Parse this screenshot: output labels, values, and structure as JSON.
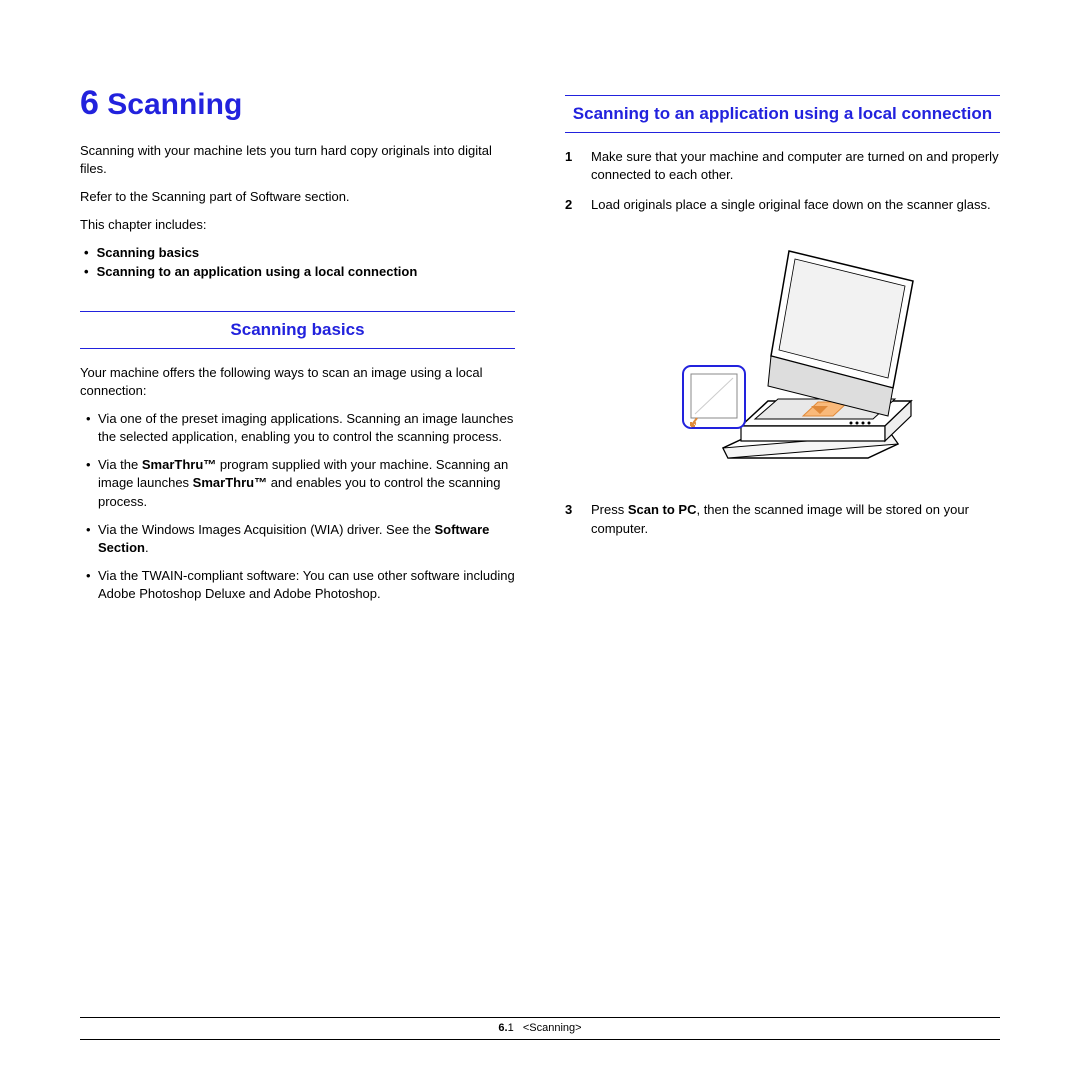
{
  "chapter": {
    "number": "6",
    "title": "Scanning"
  },
  "intro": {
    "p1": "Scanning with your machine lets you turn hard copy originals into digital files.",
    "p2": "Refer to the Scanning part of Software section.",
    "p3": "This chapter includes:"
  },
  "toc": {
    "item1": "Scanning basics",
    "item2": "Scanning to an application using a local connection"
  },
  "section1": {
    "heading": "Scanning basics",
    "intro": "Your machine offers the following ways to scan an image using a local connection:",
    "b1": "Via one of the preset imaging applications. Scanning an image launches the selected application, enabling you to control the scanning process.",
    "b2a": "Via the ",
    "b2b": "SmarThru™",
    "b2c": " program supplied with your machine. Scanning an image launches ",
    "b2d": "SmarThru™",
    "b2e": " and enables you to control the scanning process.",
    "b3a": "Via the Windows Images Acquisition (WIA) driver. See the ",
    "b3b": "Software Section",
    "b3c": ".",
    "b4": "Via the TWAIN-compliant software: You can use other software including Adobe Photoshop Deluxe and Adobe Photoshop."
  },
  "section2": {
    "heading": "Scanning to an application using a local connection",
    "step1": "Make sure that your machine and computer are turned on and properly connected to each other.",
    "step2": "Load originals place a single original face down on the scanner glass.",
    "step3a": "Press ",
    "step3b": "Scan to PC",
    "step3c": ", then the scanned image will be stored on your computer."
  },
  "footer": {
    "chapter": "6",
    "page": "1",
    "label": "<Scanning>"
  }
}
